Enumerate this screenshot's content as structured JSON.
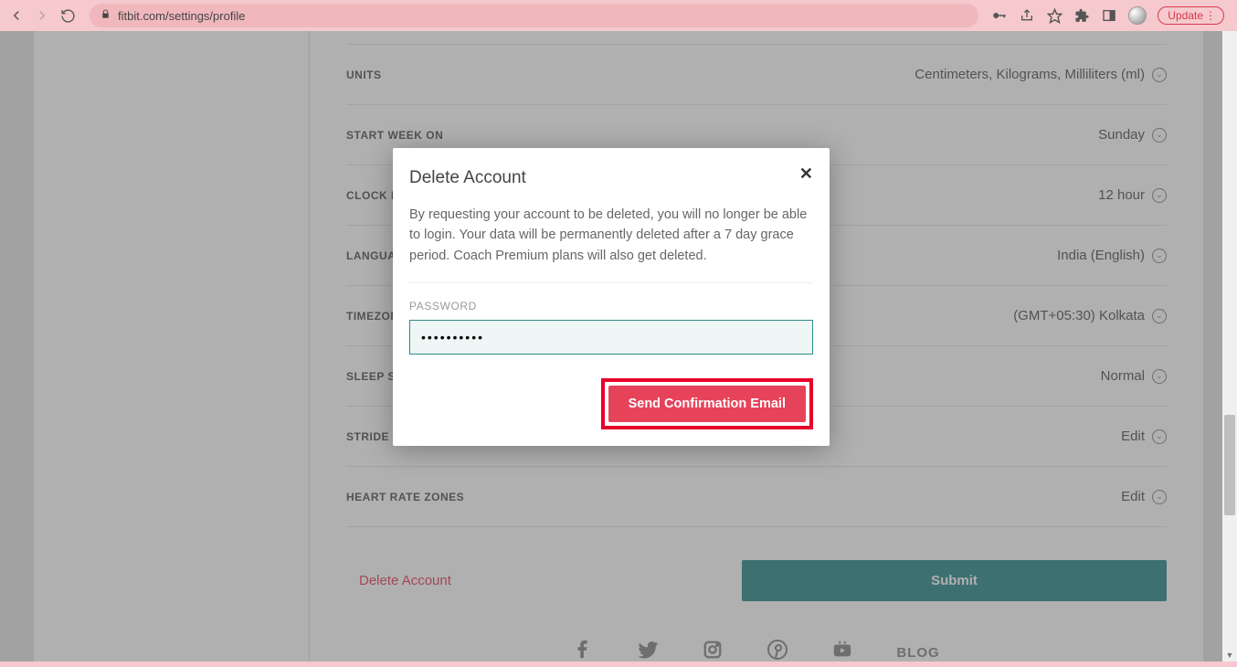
{
  "browser": {
    "url": "fitbit.com/settings/profile",
    "update_label": "Update"
  },
  "settings": [
    {
      "label": "UNITS",
      "value": "Centimeters, Kilograms, Milliliters (ml)"
    },
    {
      "label": "START WEEK ON",
      "value": "Sunday"
    },
    {
      "label": "CLOCK DISPLAY TIME",
      "value": "12 hour"
    },
    {
      "label": "LANGUAGE",
      "value": "India (English)"
    },
    {
      "label": "TIMEZONE",
      "value": "(GMT+05:30) Kolkata"
    },
    {
      "label": "SLEEP SENSITIVITY",
      "value": "Normal"
    },
    {
      "label": "STRIDE LENGTH",
      "value": "Edit"
    },
    {
      "label": "HEART RATE ZONES",
      "value": "Edit"
    }
  ],
  "actions": {
    "delete_link": "Delete Account",
    "submit": "Submit"
  },
  "footer": {
    "blog": "BLOG"
  },
  "modal": {
    "title": "Delete Account",
    "body": "By requesting your account to be deleted, you will no longer be able to login. Your data will be permanently deleted after a 7 day grace period. Coach Premium plans will also get deleted.",
    "password_label": "PASSWORD",
    "password_value": "••••••••••",
    "confirm": "Send Confirmation Email"
  }
}
